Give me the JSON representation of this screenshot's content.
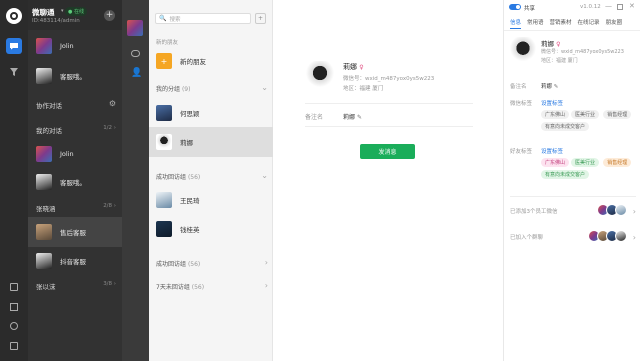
{
  "app": {
    "name": "微聊通",
    "status": "在线",
    "account_id": "ID:483114/admin"
  },
  "chats": [
    {
      "name": "Jolin"
    },
    {
      "name": "客服哦。"
    }
  ],
  "collab": {
    "title": "协作对话"
  },
  "my_chats": {
    "title": "我的对话",
    "count": "1/2"
  },
  "my_items": [
    {
      "name": "Jolin"
    },
    {
      "name": "客服哦。"
    }
  ],
  "zhang": {
    "title": "张晓涵",
    "count": "2/8"
  },
  "zhang_items": [
    {
      "name": "售后客服"
    },
    {
      "name": "抖音客服"
    }
  ],
  "zhang2": {
    "title": "张以沫",
    "count": "3/8"
  },
  "search": {
    "placeholder": "搜索"
  },
  "contacts": {
    "new_friends_header": "新的朋友",
    "new_friends": "新的朋友",
    "groups": {
      "label": "我的分组",
      "count": "(9)"
    },
    "group_items": [
      {
        "name": "何思颖"
      },
      {
        "name": "莉娜"
      }
    ],
    "success": {
      "label": "成功回访组",
      "count": "(56)"
    },
    "success_items": [
      {
        "name": "王民琦"
      },
      {
        "name": "钱桂英"
      }
    ],
    "success2": {
      "label": "成功回访组",
      "count": "(56)"
    },
    "unvisit": {
      "label": "7天未回访组",
      "count": "(56)"
    }
  },
  "profile": {
    "name": "莉娜",
    "wechat": "微信号：wxid_m487yox0ys5w223",
    "region": "地区：福建 厦门",
    "note_label": "备注名",
    "note_value": "莉娜",
    "send_button": "发消息"
  },
  "side": {
    "toggle_label": "共享",
    "version": "v1.0.12",
    "tabs": [
      "信息",
      "常用语",
      "营销素材",
      "在线记录",
      "朋友圈"
    ],
    "name": "莉娜",
    "wechat": "微信号：wxid_m487yox0ys5w223",
    "region": "地区：福建 厦门",
    "note_label": "备注名",
    "note_value": "莉娜",
    "wx_tag_label": "微信标签",
    "set_tag": "设置标签",
    "wx_tags": [
      "广东佛山",
      "医美行业",
      "销售经理",
      "有意向未成交客户"
    ],
    "friend_tag_label": "好友标签",
    "set_tag2": "设置标签",
    "friend_tags": [
      "广东佛山",
      "医美行业",
      "销售经理",
      "有意向未成交客户"
    ],
    "staff_added": "已添加3个员工微信",
    "groups_joined": "已加入个群聊"
  }
}
